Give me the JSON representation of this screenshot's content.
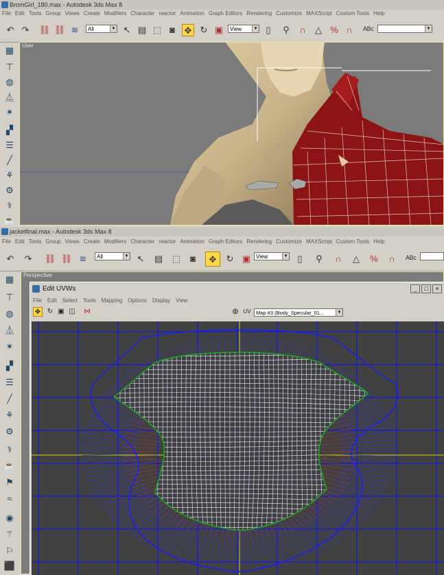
{
  "window1": {
    "title": "BromGirl_180.max - Autodesk 3ds Max 8",
    "menu": [
      "File",
      "Edit",
      "Tools",
      "Group",
      "Views",
      "Create",
      "Modifiers",
      "Character",
      "reactor",
      "Animation",
      "Graph Editors",
      "Rendering",
      "Customize",
      "MAXScript",
      "Custom Tools",
      "Help"
    ],
    "selection_filter": "All",
    "coord_system": "View",
    "viewport_label": "User"
  },
  "window2": {
    "title": "jacketfinal.max - Autodesk 3ds Max 8",
    "menu": [
      "File",
      "Edit",
      "Tools",
      "Group",
      "Views",
      "Create",
      "Modifiers",
      "Character",
      "reactor",
      "Animation",
      "Graph Editors",
      "Rendering",
      "Customize",
      "MAXScript",
      "Custom Tools",
      "Help"
    ],
    "selection_filter": "All",
    "coord_system": "View",
    "viewport_label": "Perspective"
  },
  "uv_editor": {
    "title": "Edit UVWs",
    "menu": [
      "File",
      "Edit",
      "Select",
      "Tools",
      "Mapping",
      "Options",
      "Display",
      "View"
    ],
    "uv_label": "UV",
    "map_select": "Map #3 (Body_Specular_01..."
  },
  "colors": {
    "ui_gray": "#d4d0c8",
    "viewport_gray": "#7b7b7b",
    "uv_background": "#414141",
    "jacket_red": "#8c1414",
    "grid_blue": "#1018d8",
    "active_yellow": "#ffd84a"
  }
}
